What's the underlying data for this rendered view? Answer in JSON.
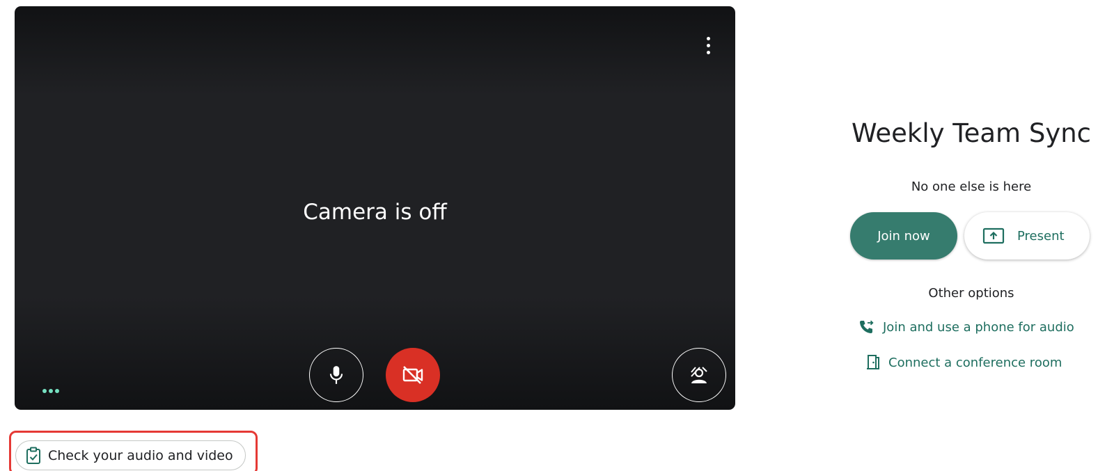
{
  "preview": {
    "camera_status": "Camera is off",
    "more_options_icon": "more-vert-icon",
    "microphone_icon": "mic-icon",
    "camera_icon": "videocam-off-icon",
    "effects_icon": "visual-effects-icon",
    "audio_indicator_icon": "audio-level-dots-icon"
  },
  "check_audio_video": {
    "label": "Check your audio and video",
    "icon": "clipboard-check-icon"
  },
  "meeting": {
    "title": "Weekly Team Sync",
    "status": "No one else is here"
  },
  "actions": {
    "join_label": "Join now",
    "present_label": "Present",
    "present_icon": "present-to-all-icon"
  },
  "other_options": {
    "heading": "Other options",
    "items": [
      {
        "label": "Join and use a phone for audio",
        "icon": "phone-forwarded-icon"
      },
      {
        "label": "Connect a conference room",
        "icon": "meeting-room-icon"
      }
    ]
  },
  "colors": {
    "accent_green": "#367c6e",
    "link_green": "#1e6e5f",
    "camera_off_red": "#d93025",
    "highlight_red": "#e53935",
    "video_background": "#202124"
  }
}
